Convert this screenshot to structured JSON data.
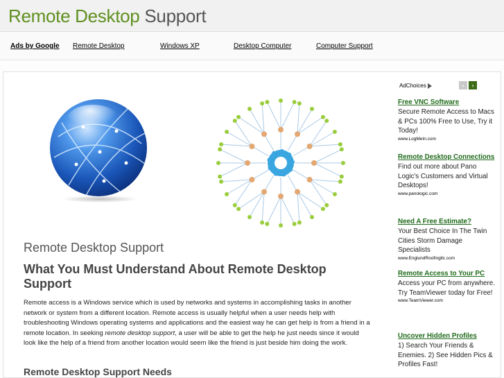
{
  "header": {
    "title_green": "Remote Desktop",
    "title_gray": " Support"
  },
  "linkbar": {
    "ads_by": "Ads by Google",
    "links": [
      "Remote Desktop",
      "Windows XP",
      "Desktop Computer",
      "Computer Support"
    ]
  },
  "main": {
    "page_title": "Remote Desktop Support",
    "heading": "What You Must Understand About Remote Desktop Support",
    "para_1": "Remote access is a Windows service which is used by networks and systems in accomplishing tasks in another network or system from a different location.  Remote access is usually helpful when a user needs help with troubleshooting Windows operating systems and applications and the easiest way he can get help is from a friend in a remote location. In seeking ",
    "para_em": "remote desktop support",
    "para_2": ", a user will be able to get the help he just needs since it would look like the help of a friend from another location would seem like the friend is just beside him doing the work.",
    "subheading": "Remote Desktop Support Needs"
  },
  "sidebar": {
    "adchoices": "AdChoices",
    "prev_label": "‹",
    "next_label": "›",
    "ads": [
      {
        "title": "Free VNC Software",
        "text": "Secure Remote Access to Macs & PCs 100% Free to Use, Try it Today!",
        "url": "www.LogMeIn.com"
      },
      {
        "title": "Remote Desktop Connections",
        "text": "Find out more about Pano Logic's Customers and Virtual Desktops!",
        "url": "www.panologic.com"
      },
      {
        "title": "Need A Free Estimate?",
        "text": "Your Best Choice In The Twin Cities Storm Damage Specialists",
        "url": "www.EnglundRoofingllc.com"
      },
      {
        "title": "Remote Access to Your PC",
        "text": "Access your PC from anywhere. Try TeamViewer today for Free!",
        "url": "www.TeamViewer.com"
      },
      {
        "title": "Uncover Hidden Profiles",
        "text": "1) Search Your Friends & Enemies. 2) See Hidden Pics & Profiles Fast!",
        "url": ""
      }
    ]
  },
  "colors": {
    "brand_green": "#5f8f1f",
    "ad_link_green": "#1f6a1a",
    "globe_blue": "#1f5fbf",
    "hub_blue": "#3aa6e0"
  },
  "icons": [
    "globe-icon",
    "network-hub-icon",
    "adchoices-icon"
  ]
}
